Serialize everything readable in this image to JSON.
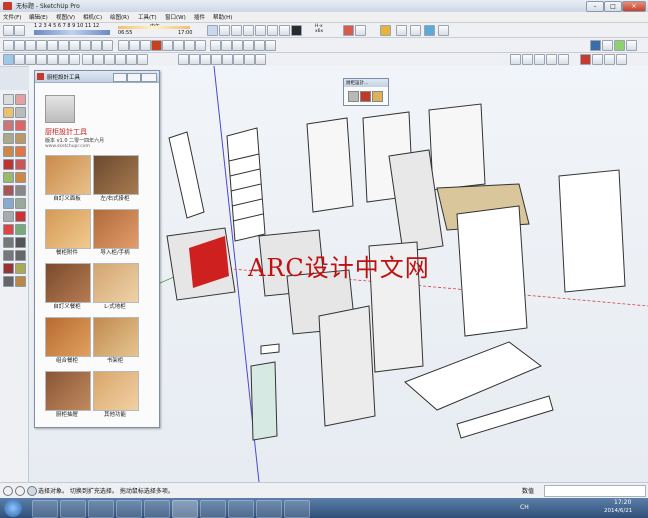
{
  "window": {
    "title": "无标题 - SketchUp Pro"
  },
  "menubar": {
    "items": [
      "文件(F)",
      "编辑(E)",
      "视图(V)",
      "相机(C)",
      "绘图(R)",
      "工具(T)",
      "窗口(W)",
      "插件",
      "帮助(H)"
    ]
  },
  "toolbar": {
    "ruler_numbers": "1 2 3 4 5 6 7 8 9 10 11 12",
    "time_start": "06:55",
    "time_noon": "中午",
    "time_end": "17:00",
    "hex_label": "H-x\nx6x"
  },
  "panel": {
    "title": "厨柜設計工具",
    "app_name": "厨柜設計工具",
    "version": "版本 v1.0 二零一四年六月",
    "website": "www.sketchupr.com",
    "items": [
      {
        "label": "自訂义面板",
        "icon": "custom-panel-icon"
      },
      {
        "label": "左/右式掛柜",
        "icon": "wall-cabinet-icon"
      },
      {
        "label": "餐柜附件",
        "icon": "cabinet-accessory-icon"
      },
      {
        "label": "导入柜/手柄",
        "icon": "import-handle-icon"
      },
      {
        "label": "自訂义餐柜",
        "icon": "custom-cabinet-icon"
      },
      {
        "label": "L-式地柜",
        "icon": "l-base-cabinet-icon"
      },
      {
        "label": "组合餐柜",
        "icon": "combo-cabinet-icon"
      },
      {
        "label": "书架柜",
        "icon": "bookshelf-icon"
      },
      {
        "label": "厨柜抽屉",
        "icon": "drawer-icon"
      },
      {
        "label": "其他功能",
        "icon": "other-functions-icon"
      }
    ]
  },
  "mini_toolbar": {
    "title": "厨柜設計..."
  },
  "watermark": {
    "text": "ARC设计中文网"
  },
  "statusbar": {
    "hint": "选择对象。 切换到扩充选择。 拖动鼠标选择多项。",
    "measure_label": "数值"
  },
  "taskbar": {
    "lang": "CH",
    "time": "17:20",
    "date": "2014/6/21"
  },
  "colors": {
    "accent": "#c01010",
    "axis_red": "#d64040",
    "axis_green": "#3a9a3a",
    "axis_blue": "#4a4ad0"
  }
}
